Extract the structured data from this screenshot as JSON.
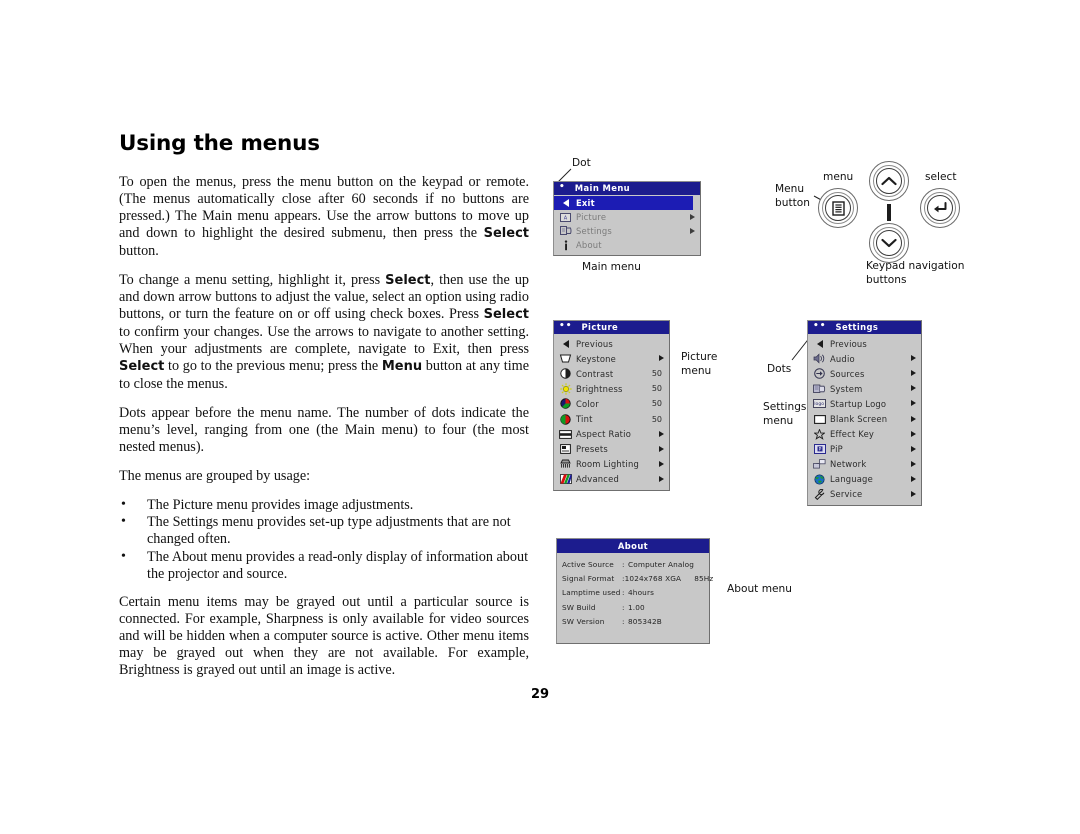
{
  "document": {
    "title": "Using the menus",
    "page_number": "29"
  },
  "body": {
    "paragraphs": [
      "To open the menus, press the menu button on the keypad or remote. (The menus automatically close after 60 seconds if no buttons are pressed.) The Main menu appears. Use the arrow buttons to move up and down to highlight the desired submenu, then press the <b>Select</b> button.",
      "To change a menu setting, highlight it, press <b>Select</b>, then use the up and down arrow buttons to adjust the value, select an option using radio buttons, or turn the feature on or off using check boxes. Press <b>Select</b> to confirm your changes. Use the arrows to navigate to another setting. When your adjustments are complete, navigate to Exit, then press <b>Select</b> to go to the previous menu; press the <b>Menu</b> button at any time to close the menus.",
      "Dots appear before the menu name. The number of dots indicate the menu’s level, ranging from one (the Main menu) to four (the most nested menus).",
      "The menus are grouped by usage:"
    ],
    "bullets": [
      "The Picture menu provides image adjustments.",
      "The Settings menu provides set-up type adjustments that are not changed often.",
      "The About menu provides a read-only display of information about the projector and source."
    ],
    "closing_paragraph": "Certain menu items may be grayed out until a particular source is connected. For example, Sharpness is only available for video sources and will be hidden when a computer source is active. Other menu items may be grayed out when they are not available. For example, Brightness is grayed out until an image is active."
  },
  "colors": {
    "osd_title_blue": "#1c1c8e",
    "osd_highlight_blue": "#1c1cb4",
    "osd_background_grey": "#c8c8c8",
    "osd_text": "#2b2b2b",
    "osd_text_greyed": "#7b7b7b"
  },
  "main_menu": {
    "title": "Main Menu",
    "level_dots": "•",
    "caption": "Main menu",
    "dot_callout": "Dot",
    "items": [
      {
        "label": "Exit",
        "icon": "triangle-left-icon",
        "arrow": "",
        "value": "",
        "state": "highlight"
      },
      {
        "label": "Picture",
        "icon": "picture-icon",
        "arrow": "▶",
        "value": "",
        "state": "greyed"
      },
      {
        "label": "Settings",
        "icon": "settings-icon",
        "arrow": "▶",
        "value": "",
        "state": "greyed"
      },
      {
        "label": "About",
        "icon": "info-icon",
        "arrow": "",
        "value": "",
        "state": "greyed"
      }
    ]
  },
  "picture_menu": {
    "title": "Picture",
    "level_dots": "••",
    "caption": "Picture\nmenu",
    "items": [
      {
        "label": "Previous",
        "icon": "triangle-left-icon",
        "arrow": "",
        "value": ""
      },
      {
        "label": "Keystone",
        "icon": "keystone-icon",
        "arrow": "▶",
        "value": ""
      },
      {
        "label": "Contrast",
        "icon": "contrast-icon",
        "arrow": "",
        "value": "50"
      },
      {
        "label": "Brightness",
        "icon": "brightness-icon",
        "arrow": "",
        "value": "50"
      },
      {
        "label": "Color",
        "icon": "color-icon",
        "arrow": "",
        "value": "50"
      },
      {
        "label": "Tint",
        "icon": "tint-icon",
        "arrow": "",
        "value": "50"
      },
      {
        "label": "Aspect Ratio",
        "icon": "aspect-ratio-icon",
        "arrow": "▶",
        "value": ""
      },
      {
        "label": "Presets",
        "icon": "presets-icon",
        "arrow": "▶",
        "value": ""
      },
      {
        "label": "Room Lighting",
        "icon": "room-lighting-icon",
        "arrow": "▶",
        "value": ""
      },
      {
        "label": "Advanced",
        "icon": "advanced-icon",
        "arrow": "▶",
        "value": ""
      }
    ]
  },
  "settings_menu": {
    "title": "Settings",
    "level_dots": "••",
    "caption": "Settings\nmenu",
    "dots_callout": "Dots",
    "items": [
      {
        "label": "Previous",
        "icon": "triangle-left-icon",
        "arrow": ""
      },
      {
        "label": "Audio",
        "icon": "audio-icon",
        "arrow": "▶"
      },
      {
        "label": "Sources",
        "icon": "sources-icon",
        "arrow": "▶"
      },
      {
        "label": "System",
        "icon": "system-icon",
        "arrow": "▶"
      },
      {
        "label": "Startup Logo",
        "icon": "startup-logo-icon",
        "arrow": "▶"
      },
      {
        "label": "Blank Screen",
        "icon": "blank-screen-icon",
        "arrow": "▶"
      },
      {
        "label": "Effect Key",
        "icon": "star-icon",
        "arrow": "▶"
      },
      {
        "label": "PiP",
        "icon": "pip-icon",
        "arrow": "▶"
      },
      {
        "label": "Network",
        "icon": "network-icon",
        "arrow": "▶"
      },
      {
        "label": "Language",
        "icon": "globe-icon",
        "arrow": "▶"
      },
      {
        "label": "Service",
        "icon": "wrench-icon",
        "arrow": "▶"
      }
    ]
  },
  "about_menu": {
    "title": "About",
    "caption": "About menu",
    "rows": [
      {
        "key": "Active Source",
        "sep": ":",
        "value": "Computer Analog",
        "value2": ""
      },
      {
        "key": "Signal Format",
        "sep": ":",
        "value": "1024x768 XGA",
        "value2": "85Hz"
      },
      {
        "key": "Lamptime used",
        "sep": ":",
        "value": "4hours",
        "value2": ""
      },
      {
        "key": "SW Build",
        "sep": ":",
        "value": "1.00",
        "value2": ""
      },
      {
        "key": "SW Version",
        "sep": ":",
        "value": "805342B",
        "value2": ""
      }
    ]
  },
  "keypad": {
    "menu_button_label": "Menu\nbutton",
    "menu_label": "menu",
    "select_label": "select",
    "caption": "Keypad navigation\nbuttons"
  }
}
